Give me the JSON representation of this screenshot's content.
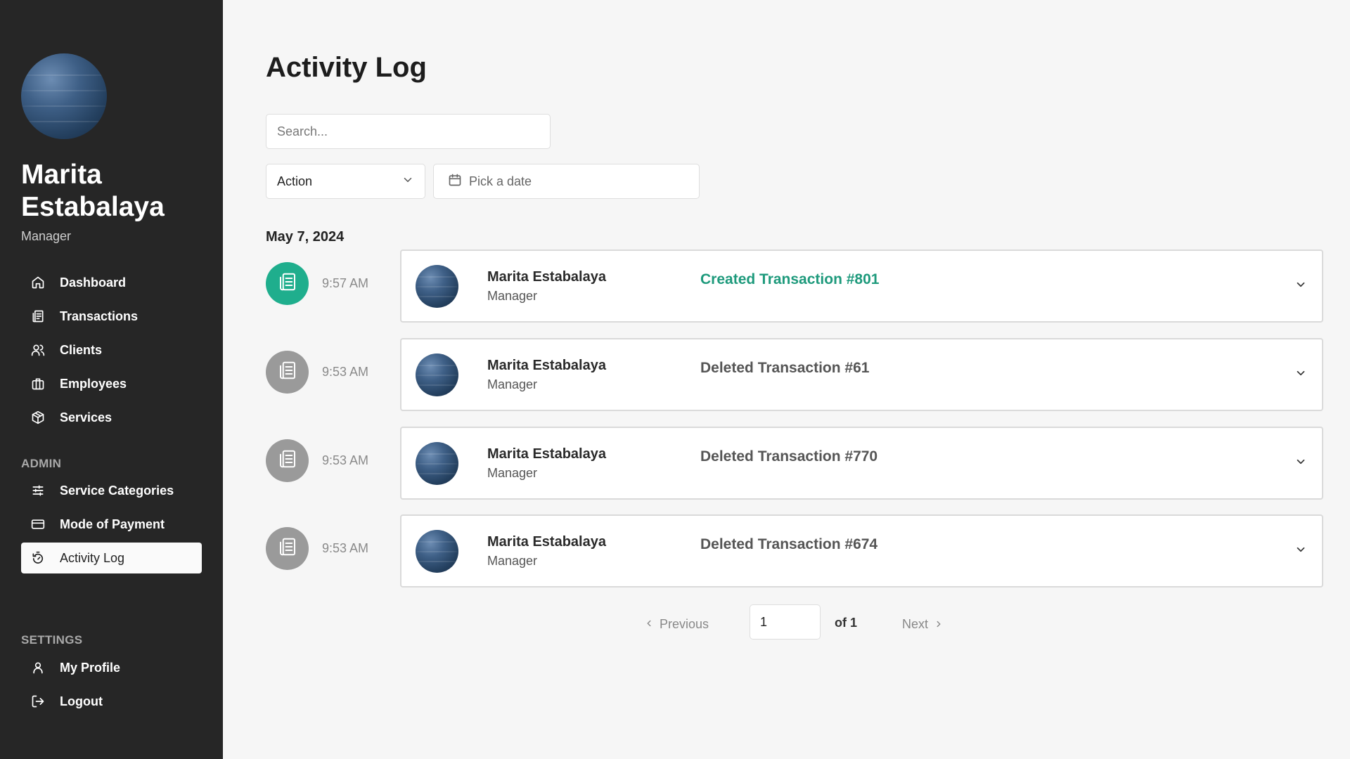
{
  "user": {
    "name": "Marita Estabalaya",
    "role": "Manager"
  },
  "nav": {
    "main": [
      {
        "label": "Dashboard",
        "icon": "home-icon"
      },
      {
        "label": "Transactions",
        "icon": "receipt-icon"
      },
      {
        "label": "Clients",
        "icon": "users-icon"
      },
      {
        "label": "Employees",
        "icon": "briefcase-icon"
      },
      {
        "label": "Services",
        "icon": "package-icon"
      }
    ],
    "admin_label": "ADMIN",
    "admin": [
      {
        "label": "Service Categories",
        "icon": "sliders-icon"
      },
      {
        "label": "Mode of Payment",
        "icon": "credit-card-icon"
      },
      {
        "label": "Activity Log",
        "icon": "timer-icon",
        "active": true
      }
    ],
    "settings_label": "SETTINGS",
    "settings": [
      {
        "label": "My Profile",
        "icon": "user-icon"
      },
      {
        "label": "Logout",
        "icon": "logout-icon"
      }
    ]
  },
  "main": {
    "title": "Activity Log",
    "search_placeholder": "Search...",
    "action_filter": "Action",
    "date_placeholder": "Pick a date",
    "group_date": "May 7, 2024",
    "entries": [
      {
        "time": "9:57 AM",
        "actor": "Marita Estabalaya",
        "role": "Manager",
        "action": "Created Transaction #801",
        "type": "create"
      },
      {
        "time": "9:53 AM",
        "actor": "Marita Estabalaya",
        "role": "Manager",
        "action": "Deleted Transaction #61",
        "type": "delete"
      },
      {
        "time": "9:53 AM",
        "actor": "Marita Estabalaya",
        "role": "Manager",
        "action": "Deleted Transaction #770",
        "type": "delete"
      },
      {
        "time": "9:53 AM",
        "actor": "Marita Estabalaya",
        "role": "Manager",
        "action": "Deleted Transaction #674",
        "type": "delete"
      }
    ]
  },
  "pagination": {
    "prev_label": "Previous",
    "page": "1",
    "of_label": "of 1",
    "next_label": "Next"
  },
  "colors": {
    "sidebar": "#262626",
    "accent": "#1fae8d",
    "muted_dot": "#9a9a9a",
    "create_text": "#1e9a7c",
    "delete_text": "#555555"
  }
}
